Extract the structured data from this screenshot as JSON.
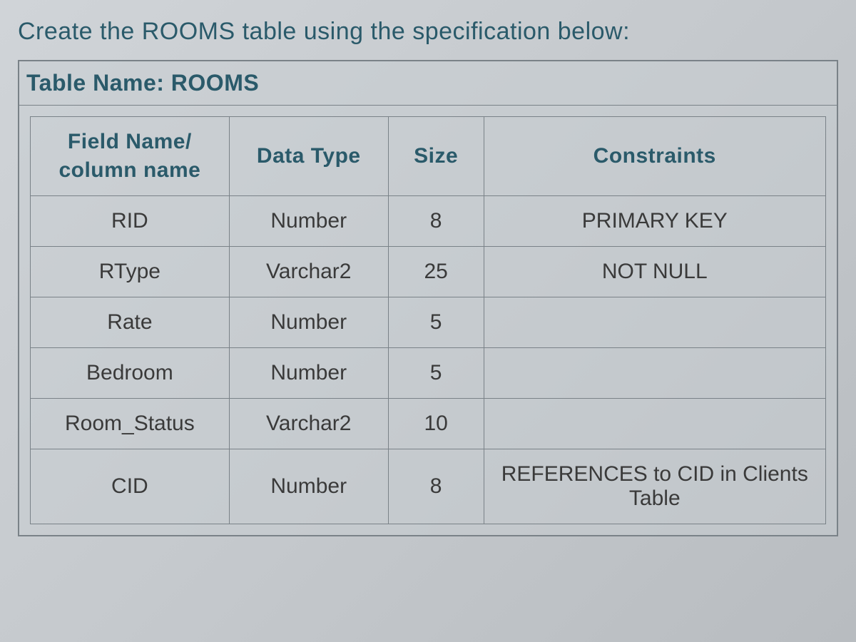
{
  "instruction": "Create the ROOMS table using the specification below:",
  "table_name_label": "Table Name: ROOMS",
  "headers": {
    "field_name_line1": "Field Name/",
    "field_name_line2": "column name",
    "data_type": "Data Type",
    "size": "Size",
    "constraints": "Constraints"
  },
  "rows": [
    {
      "field": "RID",
      "type": "Number",
      "size": "8",
      "constraints": "PRIMARY KEY"
    },
    {
      "field": "RType",
      "type": "Varchar2",
      "size": "25",
      "constraints": "NOT NULL"
    },
    {
      "field": "Rate",
      "type": "Number",
      "size": "5",
      "constraints": ""
    },
    {
      "field": "Bedroom",
      "type": "Number",
      "size": "5",
      "constraints": ""
    },
    {
      "field": "Room_Status",
      "type": "Varchar2",
      "size": "10",
      "constraints": ""
    },
    {
      "field": "CID",
      "type": "Number",
      "size": "8",
      "constraints": "REFERENCES to CID in Clients Table"
    }
  ]
}
